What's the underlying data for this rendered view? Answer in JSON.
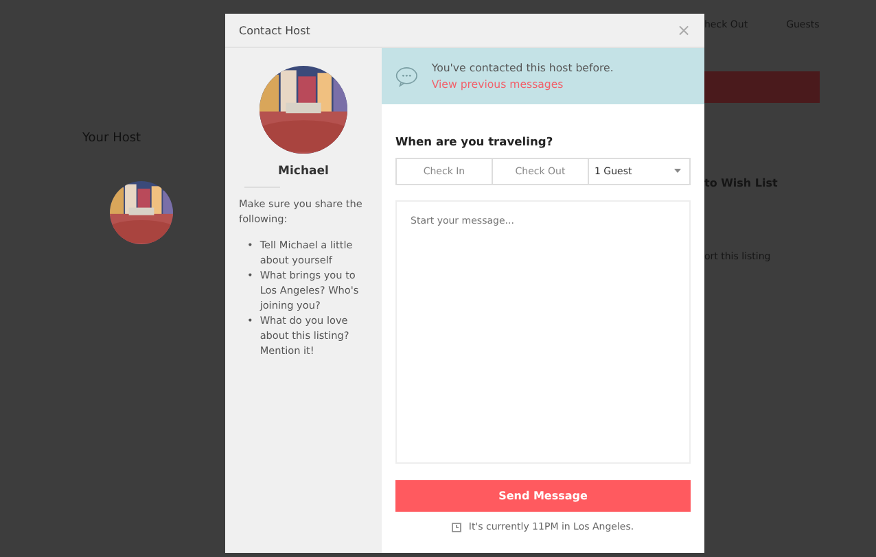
{
  "background": {
    "host_heading": "Your Host",
    "booking_labels": [
      "heck Out",
      "Guests"
    ],
    "wish_list": "to Wish List",
    "report": "ort this listing"
  },
  "modal": {
    "title": "Contact Host",
    "close": "×",
    "host": {
      "name": "Michael"
    },
    "tips": {
      "intro": "Make sure you share the following:",
      "items": [
        {
          "marker": "•",
          "text": "Tell Michael a little about yourself"
        },
        {
          "marker": "•",
          "text": "What brings you to Los Angeles? Who's joining you?"
        },
        {
          "marker": "•",
          "text": "What do you love about this listing? Mention it!"
        }
      ]
    },
    "notice": {
      "text": "You've contacted this host before.",
      "link": "View previous messages"
    },
    "question": "When are you traveling?",
    "check_in": {
      "placeholder": "Check In"
    },
    "check_out": {
      "placeholder": "Check Out"
    },
    "guests": {
      "value": "1 Guest"
    },
    "message": {
      "placeholder": "Start your message..."
    },
    "send": "Send Message",
    "local_time": "It's currently 11PM in Los Angeles."
  }
}
